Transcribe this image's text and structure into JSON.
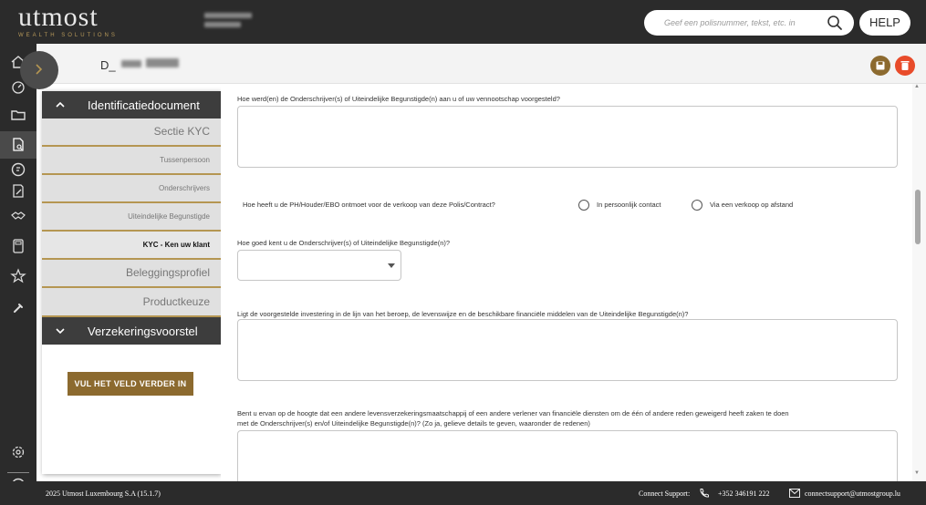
{
  "header": {
    "logo_main": "utmost",
    "logo_sub": "WEALTH SOLUTIONS",
    "search_placeholder": "Geef een polisnummer, tekst, etc. in",
    "help_label": "HELP"
  },
  "subheader": {
    "case_id_prefix": "D_"
  },
  "nav": {
    "section1_label": "Identificatiedocument",
    "items": [
      {
        "label": "Sectie KYC"
      },
      {
        "label": "Tussenpersoon"
      },
      {
        "label": "Onderschrijvers"
      },
      {
        "label": "Uiteindelijke Begunstigde"
      },
      {
        "label": "KYC - Ken uw klant"
      },
      {
        "label": "Beleggingsprofiel"
      },
      {
        "label": "Productkeuze"
      }
    ],
    "section2_label": "Verzekeringsvoorstel",
    "fill_button_label": "VUL HET VELD VERDER IN"
  },
  "form": {
    "q1": "Hoe werd(en) de Onderschrijver(s) of Uiteindelijke Begunstigde(n) aan u of uw vennootschap voorgesteld?",
    "q2": "Hoe heeft u de PH/Houder/EBO ontmoet voor de verkoop van deze Polis/Contract?",
    "q2_option1": "In persoonlijk contact",
    "q2_option2": "Via een verkoop op afstand",
    "q3": "Hoe goed kent u de Onderschrijver(s) of Uiteindelijke Begunstigde(n)?",
    "q4": "Ligt de voorgestelde investering in de lijn van het beroep, de levenswijze en de beschikbare financiële middelen van de Uiteindelijke Begunstigde(n)?",
    "q5_line1": "Bent u ervan op de hoogte dat een andere levensverzekeringsmaatschappij of een andere verlener van financiële diensten om de één of andere reden geweigerd heeft zaken te doen",
    "q5_line2": "met de Onderschrijver(s) en/of Uiteindelijke Begunstigde(n)? (Zo ja, gelieve details te geven, waaronder de redenen)"
  },
  "footer": {
    "copyright": "2025 Utmost Luxembourg S.A (15.1.7)",
    "support_label": "Connect Support:",
    "phone": "+352 346191 222",
    "email": "connectsupport@utmostgroup.lu"
  },
  "colors": {
    "dark": "#2b2b2b",
    "gold": "#b59652",
    "button_brown": "#8c6a2f",
    "delete_red": "#e84b2a"
  }
}
